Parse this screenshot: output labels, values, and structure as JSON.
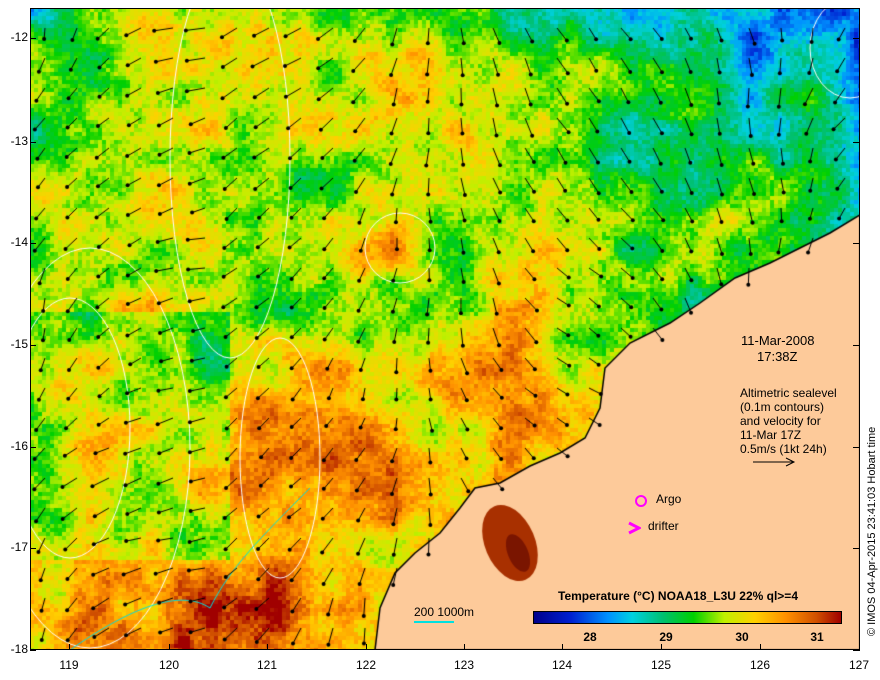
{
  "map": {
    "lon_ticks": [
      "119",
      "120",
      "121",
      "122",
      "123",
      "124",
      "125",
      "126",
      "127"
    ],
    "lat_ticks": [
      "-12",
      "-13",
      "-14",
      "-15",
      "-16",
      "-17",
      "-18"
    ],
    "date": "11-Mar-2008",
    "time": "17:38Z",
    "altimetry_note": [
      "Altimetric sealevel",
      "(0.1m contours)",
      "and velocity for",
      "11-Mar 17Z",
      "0.5m/s (1kt 24h)"
    ],
    "legend_argo": "Argo",
    "legend_drifter": "drifter",
    "isobath_label": "200  1000m",
    "colorbar_title": "Temperature (°C) NOAA18_L3U 22% ql>=4",
    "colorbar_ticks": [
      "28",
      "29",
      "30",
      "31"
    ],
    "copyright": "© IMOS 04-Apr-2015 23:41:03 Hobart time",
    "colors": {
      "land": "#fdca9a",
      "argo": "#ff00ff",
      "isobath": "#00e0e0",
      "contour": "#ffffff"
    }
  }
}
